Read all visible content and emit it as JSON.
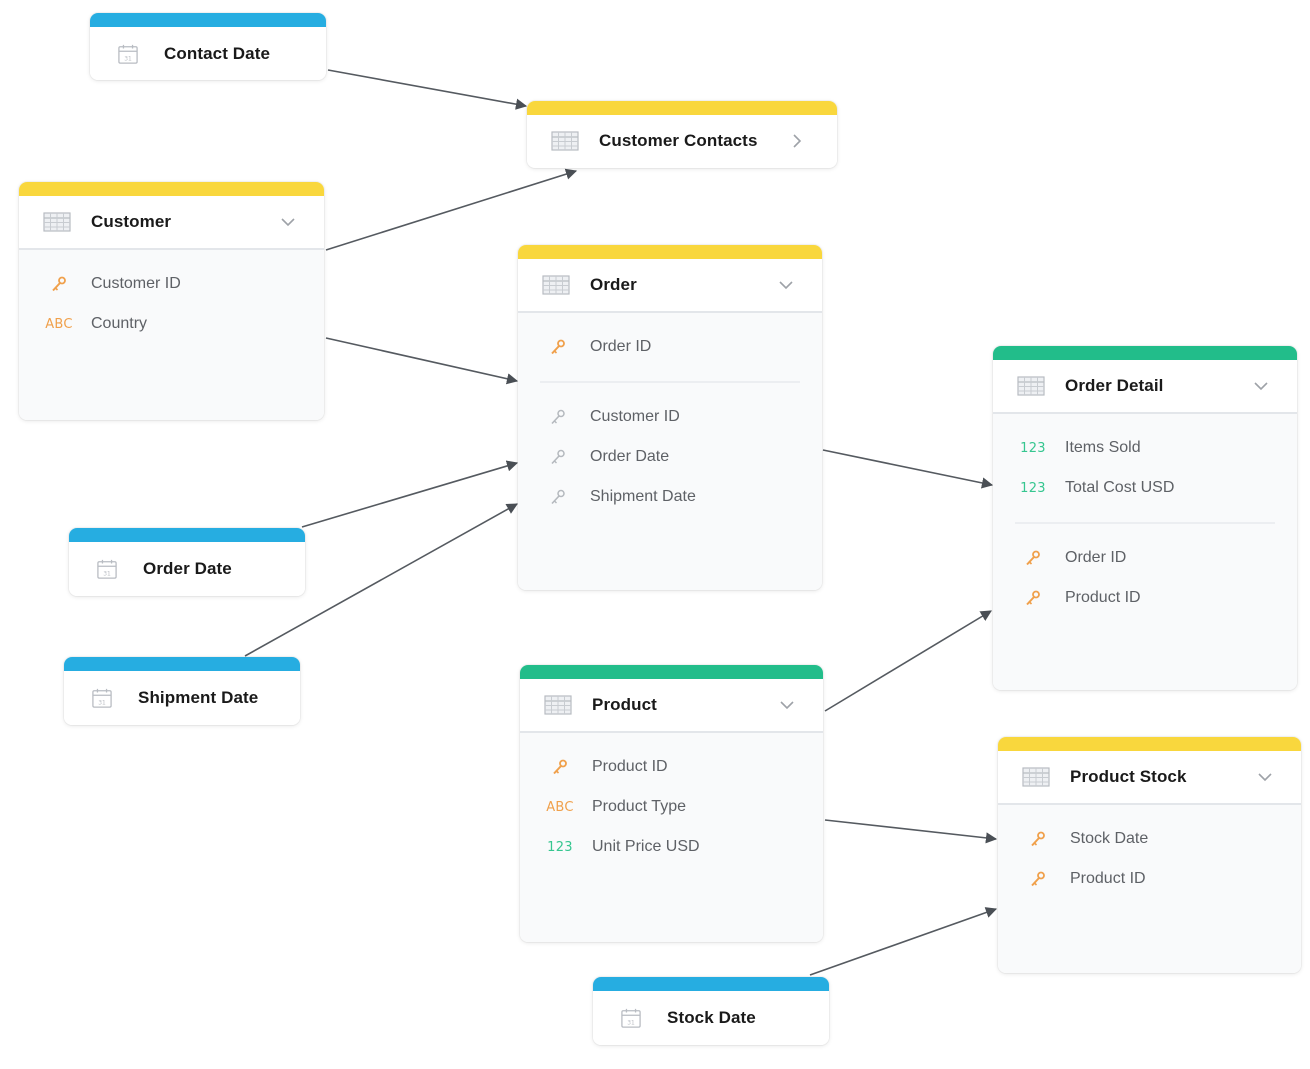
{
  "colors": {
    "date_bar": "#26ade1",
    "dataset_bar_yellow": "#f9d73d",
    "dataset_bar_green": "#22bd8a",
    "key_orange": "#f0a04b",
    "key_gray": "#b5b9be",
    "number_green": "#36c690",
    "edge": "#555a60"
  },
  "nodes": {
    "contact_date": {
      "title": "Contact Date",
      "kind": "date",
      "icon": "calendar-icon"
    },
    "customer_contacts": {
      "title": "Customer Contacts",
      "kind": "dataset",
      "icon": "table-icon",
      "toggle": "chevron-right-icon"
    },
    "customer": {
      "title": "Customer",
      "kind": "dataset",
      "icon": "table-icon",
      "toggle": "chevron-down-icon",
      "fields": [
        {
          "name": "Customer ID",
          "type": "primary-key-icon",
          "type_label": ""
        },
        {
          "name": "Country",
          "type": "attribute",
          "type_label": "ABC"
        }
      ]
    },
    "order": {
      "title": "Order",
      "kind": "dataset",
      "icon": "table-icon",
      "toggle": "chevron-down-icon",
      "fields": [
        {
          "name": "Order ID",
          "type": "primary-key-icon"
        },
        {
          "name": "Customer ID",
          "type": "reference-key-icon"
        },
        {
          "name": "Order Date",
          "type": "reference-key-icon"
        },
        {
          "name": "Shipment Date",
          "type": "reference-key-icon"
        }
      ]
    },
    "order_detail": {
      "title": "Order Detail",
      "kind": "dataset",
      "icon": "table-icon",
      "toggle": "chevron-down-icon",
      "fields": [
        {
          "name": "Items Sold",
          "type": "fact",
          "type_label": "123"
        },
        {
          "name": "Total Cost USD",
          "type": "fact",
          "type_label": "123"
        },
        {
          "name": "Order ID",
          "type": "primary-key-icon"
        },
        {
          "name": "Product ID",
          "type": "primary-key-icon"
        }
      ]
    },
    "order_date": {
      "title": "Order Date",
      "kind": "date",
      "icon": "calendar-icon"
    },
    "shipment_date": {
      "title": "Shipment Date",
      "kind": "date",
      "icon": "calendar-icon"
    },
    "product": {
      "title": "Product",
      "kind": "dataset",
      "icon": "table-icon",
      "toggle": "chevron-down-icon",
      "fields": [
        {
          "name": "Product ID",
          "type": "primary-key-icon"
        },
        {
          "name": "Product Type",
          "type": "attribute",
          "type_label": "ABC"
        },
        {
          "name": "Unit Price USD",
          "type": "fact",
          "type_label": "123"
        }
      ]
    },
    "product_stock": {
      "title": "Product Stock",
      "kind": "dataset",
      "icon": "table-icon",
      "toggle": "chevron-down-icon",
      "fields": [
        {
          "name": "Stock Date",
          "type": "primary-key-icon"
        },
        {
          "name": "Product ID",
          "type": "primary-key-icon"
        }
      ]
    },
    "stock_date": {
      "title": "Stock Date",
      "kind": "date",
      "icon": "calendar-icon"
    }
  },
  "edges": [
    {
      "from": "contact_date",
      "to": "customer_contacts"
    },
    {
      "from": "customer",
      "to": "customer_contacts"
    },
    {
      "from": "customer",
      "to": "order"
    },
    {
      "from": "order_date",
      "to": "order"
    },
    {
      "from": "shipment_date",
      "to": "order"
    },
    {
      "from": "order",
      "to": "order_detail"
    },
    {
      "from": "product",
      "to": "order_detail"
    },
    {
      "from": "product",
      "to": "product_stock"
    },
    {
      "from": "stock_date",
      "to": "product_stock"
    }
  ]
}
